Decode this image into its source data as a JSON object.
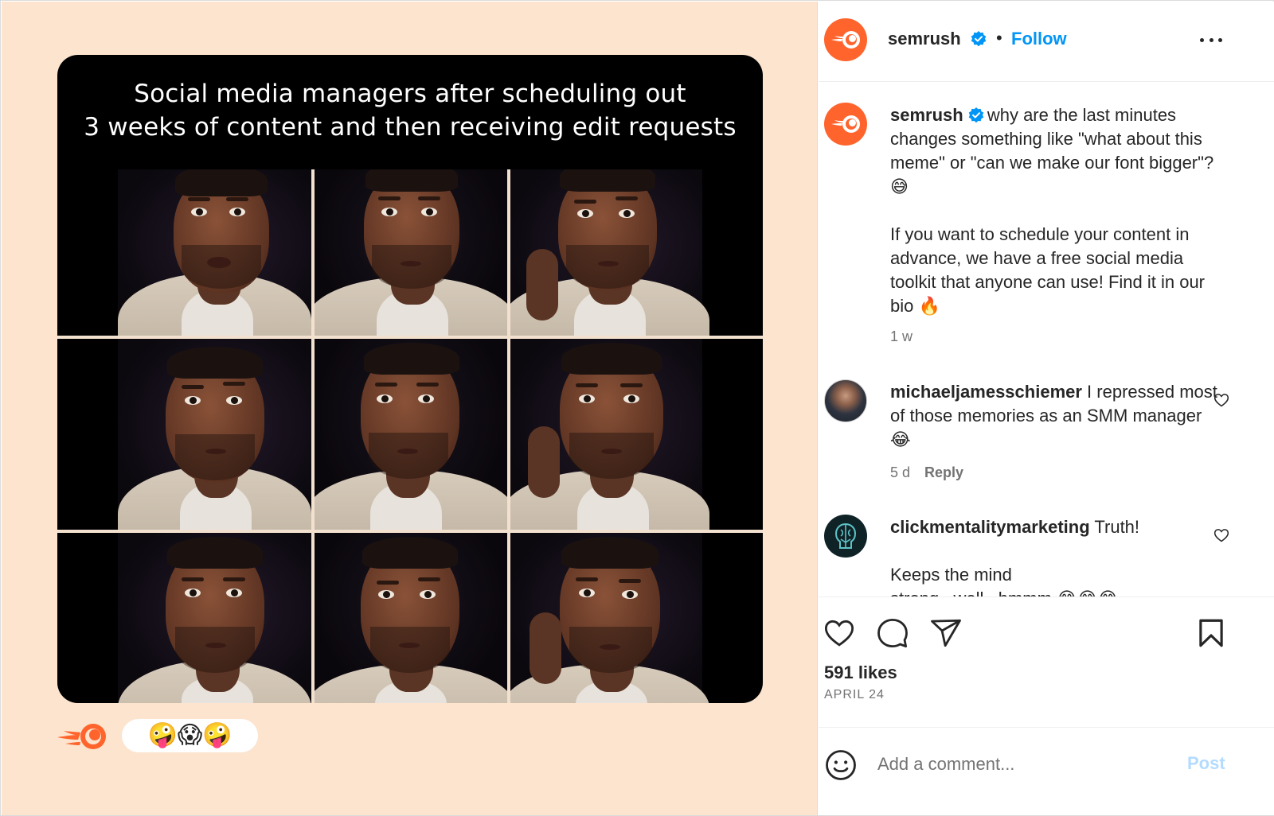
{
  "media": {
    "meme_title_line1": "Social media managers after scheduling out",
    "meme_title_line2": "3 weeks of content and then receiving edit requests",
    "reactions": "🤪😱🤪",
    "brand_color": "#ff642d"
  },
  "header": {
    "username": "semrush",
    "dot": "•",
    "follow_label": "Follow"
  },
  "caption": {
    "username": "semrush",
    "text": " why are the last minutes changes something like \"what about this meme\" or \"can we make our font bigger\"? 😅\n\nIf you want to schedule your content in advance, we have a free social media toolkit that anyone can use! Find it in our bio 🔥",
    "time": "1 w"
  },
  "comments": [
    {
      "username": "michaeljamesschiemer",
      "text": " I repressed most of those memories as an SMM manager 😂",
      "time": "5 d",
      "reply_label": "Reply"
    },
    {
      "username": "clickmentalitymarketing",
      "text": " Truth!\n\nKeeps the mind\nstrong...well...hmmm 😂😂😂"
    }
  ],
  "actions": {
    "likes": "591 likes",
    "date": "APRIL 24"
  },
  "add_comment": {
    "placeholder": "Add a comment...",
    "post_label": "Post"
  }
}
